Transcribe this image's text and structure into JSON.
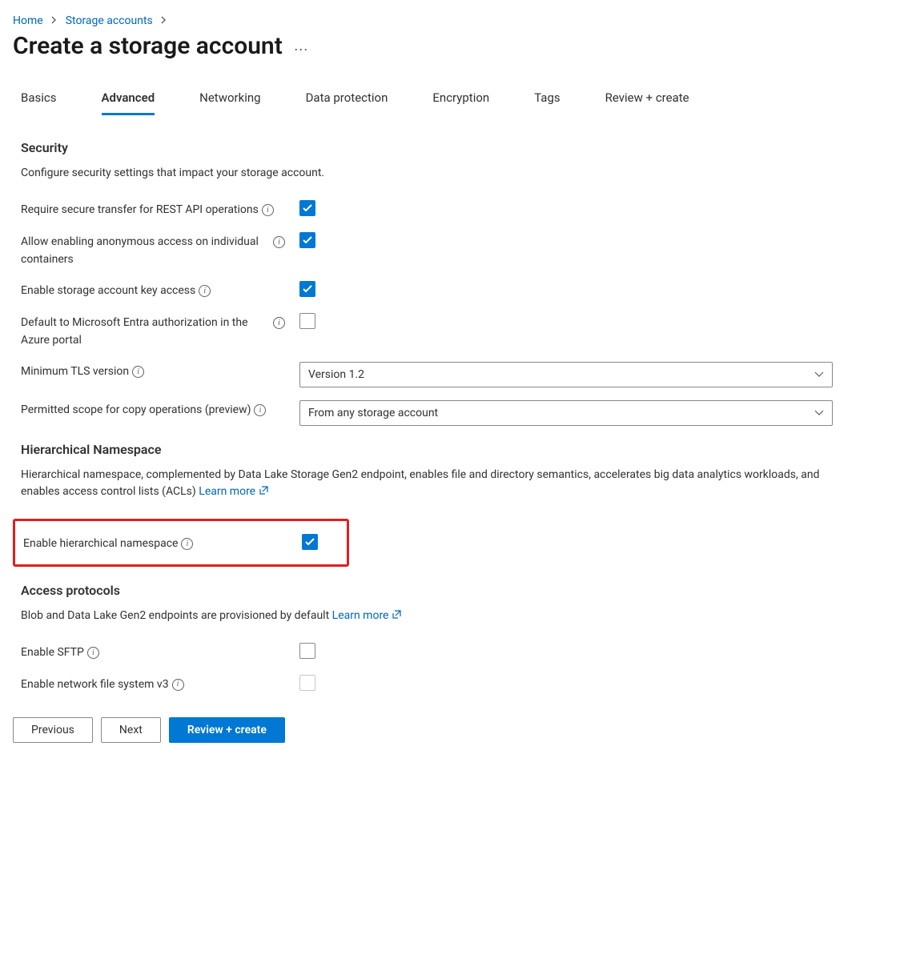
{
  "breadcrumb": {
    "items": [
      "Home",
      "Storage accounts"
    ]
  },
  "page_title": "Create a storage account",
  "tabs": {
    "items": [
      "Basics",
      "Advanced",
      "Networking",
      "Data protection",
      "Encryption",
      "Tags",
      "Review + create"
    ],
    "active": "Advanced"
  },
  "security": {
    "heading": "Security",
    "description": "Configure security settings that impact your storage account.",
    "require_secure_transfer_label": "Require secure transfer for REST API operations",
    "allow_anonymous_label": "Allow enabling anonymous access on individual containers",
    "enable_key_access_label": "Enable storage account key access",
    "default_entra_label": "Default to Microsoft Entra authorization in the Azure portal",
    "min_tls_label": "Minimum TLS version",
    "min_tls_value": "Version 1.2",
    "copy_scope_label": "Permitted scope for copy operations (preview)",
    "copy_scope_value": "From any storage account"
  },
  "hns": {
    "heading": "Hierarchical Namespace",
    "description": "Hierarchical namespace, complemented by Data Lake Storage Gen2 endpoint, enables file and directory semantics, accelerates big data analytics workloads, and enables access control lists (ACLs)",
    "learn_more": "Learn more",
    "enable_label": "Enable hierarchical namespace"
  },
  "access_protocols": {
    "heading": "Access protocols",
    "description": "Blob and Data Lake Gen2 endpoints are provisioned by default",
    "learn_more": "Learn more",
    "enable_sftp_label": "Enable SFTP",
    "enable_nfs_label": "Enable network file system v3"
  },
  "footer": {
    "previous": "Previous",
    "next": "Next",
    "review": "Review + create"
  }
}
